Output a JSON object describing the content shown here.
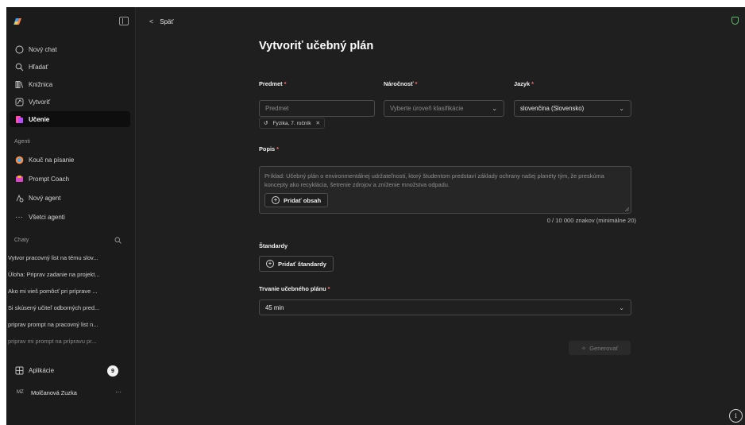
{
  "sidebar": {
    "nav": [
      {
        "label": "Nový chat",
        "icon": "chat-bubble-icon"
      },
      {
        "label": "Hľadať",
        "icon": "search-icon"
      },
      {
        "label": "Knižnica",
        "icon": "library-icon"
      },
      {
        "label": "Vytvoriť",
        "icon": "create-icon"
      },
      {
        "label": "Učenie",
        "icon": "learning-icon",
        "active": true
      }
    ],
    "agents_label": "Agenti",
    "agents": [
      {
        "label": "Kouč na písanie",
        "icon": "writing-coach-icon"
      },
      {
        "label": "Prompt Coach",
        "icon": "prompt-coach-icon"
      },
      {
        "label": "Nový agent",
        "icon": "new-agent-icon"
      },
      {
        "label": "Všetci agenti",
        "icon": "more-icon"
      }
    ],
    "chats_label": "Chaty",
    "chats": [
      "Vytvor pracovný list na tému slov...",
      "Úloha: Priprav zadanie na projekt...",
      "Ako mi vieš pomôcť pri príprave ...",
      "Si skúsený učiteľ odborných pred...",
      "priprav prompt na pracovný list n...",
      "priprav mi prompt na prípravu pr..."
    ],
    "apps_label": "Aplikácie",
    "apps_badge": "9",
    "user_initials": "MZ",
    "user_name": "Molčanová Zuzka",
    "user_more": "···"
  },
  "header": {
    "back_label": "Späť"
  },
  "form": {
    "title": "Vytvoriť učebný plán",
    "subject_label": "Predmet",
    "subject_placeholder": "Predmet",
    "difficulty_label": "Náročnosť",
    "difficulty_placeholder": "Vyberte úroveň klasifikácie",
    "language_label": "Jazyk",
    "language_value": "slovenčina (Slovensko)",
    "required_mark": "*",
    "chip_label": "Fyzika, 7. ročník",
    "description_label": "Popis",
    "description_placeholder": "Príklad: Učebný plán o environmentálnej udržateľnosti, ktorý študentom predstaví základy ochrany našej planéty tým, že preskúma koncepty ako recyklácia, šetrenie zdrojov a zníženie množstva odpadu.",
    "add_content_label": "Pridať obsah",
    "counter": "0 / 10 000 znakov (minimálne 20)",
    "standards_label": "Štandardy",
    "add_standards_label": "Pridať štandardy",
    "duration_label": "Trvanie učebného plánu",
    "duration_value": "45 min",
    "generate_label": "Generovať"
  },
  "colors": {
    "background": "#1f1f1f",
    "sidebar": "#1b1b1b",
    "required": "#ff6b6b",
    "shield": "#5cc06b"
  }
}
